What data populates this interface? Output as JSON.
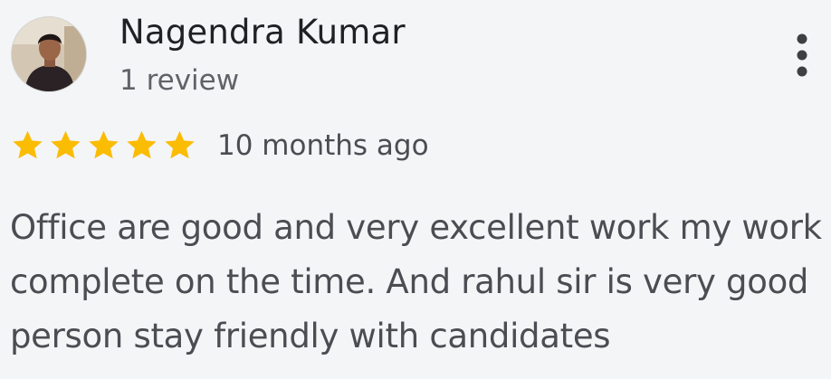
{
  "reviewer": {
    "name": "Nagendra Kumar",
    "review_count": "1 review",
    "avatar_icon": "user-photo"
  },
  "rating": {
    "stars": 5,
    "max_stars": 5,
    "star_color": "#fbbc04",
    "time_ago": "10 months ago"
  },
  "review": {
    "text": "Office are good and very excellent work my work complete on the time. And rahul sir is very good person stay friendly with candidates"
  },
  "menu": {
    "icon": "more-vert-icon"
  },
  "colors": {
    "background": "#f4f5f7",
    "name_text": "#202124",
    "secondary_text": "#5f6368",
    "body_text": "#4a4d52",
    "menu_dots": "#3c4043"
  }
}
